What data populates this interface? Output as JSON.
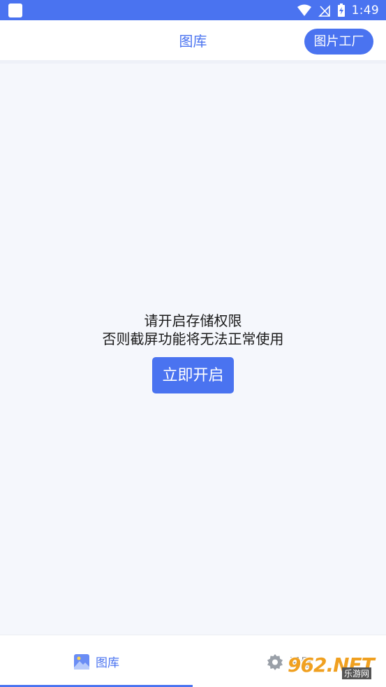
{
  "status_bar": {
    "time": "1:49",
    "icons": [
      "notification-square-icon",
      "wifi-icon",
      "no-signal-icon",
      "battery-charging-icon"
    ]
  },
  "app_bar": {
    "title": "图库",
    "factory_button_label": "图片工厂"
  },
  "content": {
    "permission_line1": "请开启存储权限",
    "permission_line2": "否则截屏功能将无法正常使用",
    "enable_button_label": "立即开启"
  },
  "bottom_nav": {
    "tabs": [
      {
        "label": "图库",
        "icon": "gallery-icon",
        "active": true
      },
      {
        "label": "设置",
        "icon": "settings-gear-icon",
        "active": false
      }
    ]
  },
  "watermark": {
    "text": "962.NET",
    "sub": "乐游网"
  },
  "colors": {
    "accent": "#4a73f0",
    "background": "#f5f7fc"
  }
}
